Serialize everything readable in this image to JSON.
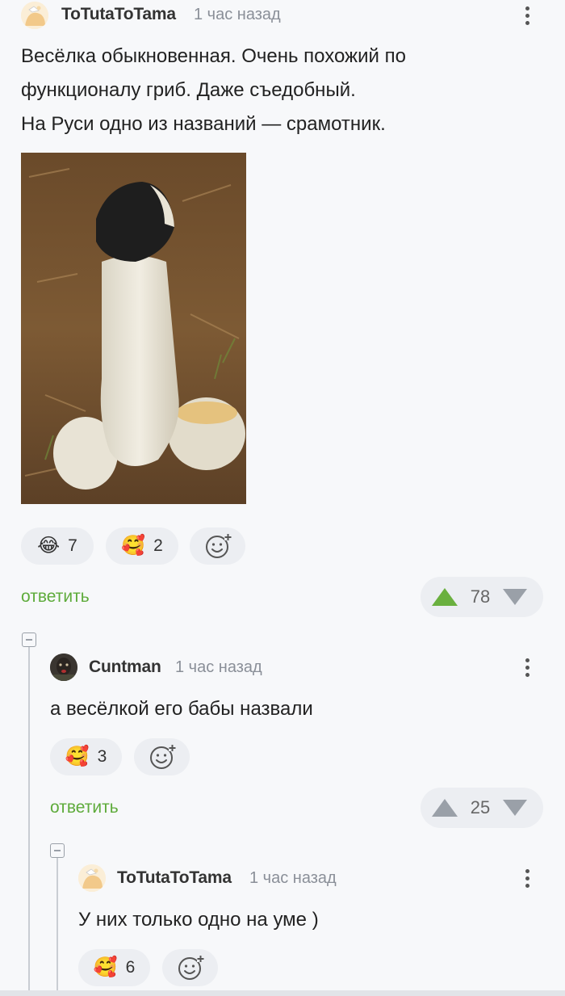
{
  "comment1": {
    "author": "ToTutaToTama",
    "time": "1 час назад",
    "text_lines": [
      "Весёлка обыкновенная. Очень похожий по",
      "функционалу гриб. Даже съедобный.",
      "На Руси одно из названий — срамотник."
    ],
    "reactions": [
      {
        "icon": "laughing-emoji",
        "count": "7"
      },
      {
        "icon": "hearts-face-emoji",
        "count": "2"
      }
    ],
    "reply_label": "ответить",
    "rating": "78"
  },
  "comment2": {
    "author": "Cuntman",
    "time": "1 час назад",
    "text": "а весёлкой его бабы назвали",
    "reactions": [
      {
        "icon": "hearts-face-emoji",
        "count": "3"
      }
    ],
    "reply_label": "ответить",
    "rating": "25"
  },
  "comment3": {
    "author": "ToTutaToTama",
    "time": "1 час назад",
    "text": "У них только одно на уме )",
    "reactions": [
      {
        "icon": "hearts-face-emoji",
        "count": "6"
      }
    ]
  },
  "colors": {
    "reply": "#5eab3b",
    "upvote_active": "#6ab03f",
    "vote_inactive": "#9aa0a8"
  }
}
